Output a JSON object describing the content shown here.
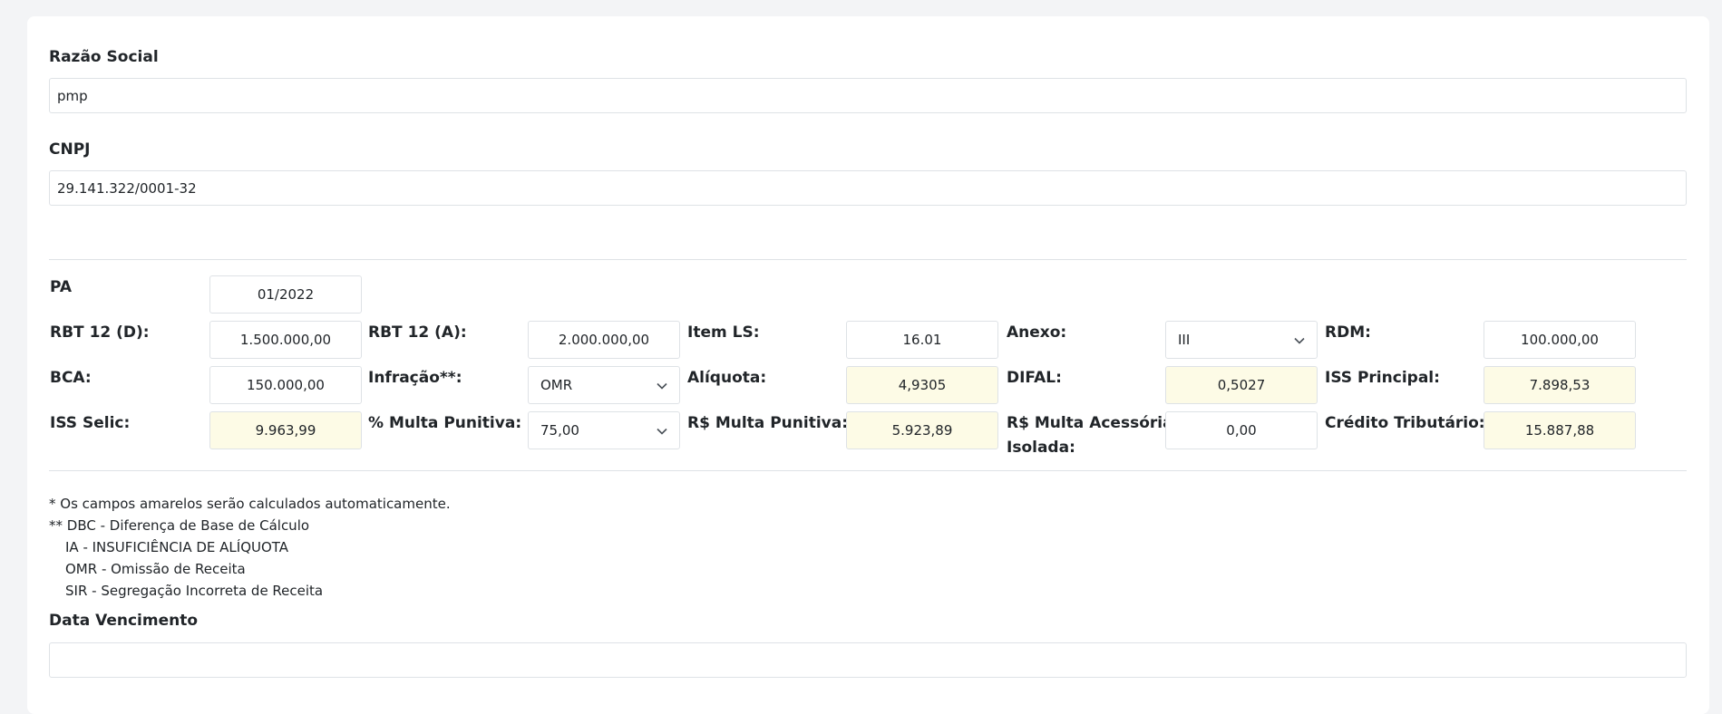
{
  "razao": {
    "label": "Razão Social",
    "value": "pmp"
  },
  "cnpj": {
    "label": "CNPJ",
    "value": "29.141.322/0001-32"
  },
  "pa": {
    "label": "PA",
    "value": "01/2022"
  },
  "rbt12d": {
    "label": "RBT 12 (D):",
    "value": "1.500.000,00"
  },
  "rbt12a": {
    "label": "RBT 12 (A):",
    "value": "2.000.000,00"
  },
  "itemls": {
    "label": "Item LS:",
    "value": "16.01"
  },
  "anexo": {
    "label": "Anexo:",
    "value": "III"
  },
  "rdm": {
    "label": "RDM:",
    "value": "100.000,00"
  },
  "bca": {
    "label": "BCA:",
    "value": "150.000,00"
  },
  "infracao": {
    "label": "Infração**:",
    "value": "OMR"
  },
  "aliquota": {
    "label": "Alíquota:",
    "value": "4,9305"
  },
  "difal": {
    "label": "DIFAL:",
    "value": "0,5027"
  },
  "iss_principal": {
    "label": "ISS Principal:",
    "value": "7.898,53"
  },
  "iss_selic": {
    "label": "ISS Selic:",
    "value": "9.963,99"
  },
  "pct_multa": {
    "label": "% Multa Punitiva:",
    "value": "75,00"
  },
  "rs_multa": {
    "label": "R$ Multa Punitiva:",
    "value": "5.923,89"
  },
  "rs_multa_acessoria": {
    "label_line1": "R$ Multa Acessória",
    "label_line2": "Isolada:",
    "value": "0,00"
  },
  "credito": {
    "label": "Crédito Tributário:",
    "value": "15.887,88"
  },
  "notes": {
    "line1": "* Os campos amarelos serão calculados automaticamente.",
    "line2": "** DBC - Diferença de Base de Cálculo",
    "line3": "IA - INSUFICIÊNCIA DE ALÍQUOTA",
    "line4": "OMR - Omissão de Receita",
    "line5": "SIR - Segregação Incorreta de Receita"
  },
  "data_vencimento": {
    "label": "Data Vencimento",
    "value": ""
  },
  "colors": {
    "calc_field_bg": "#fdfbe6",
    "border": "#dee2e6",
    "page_bg": "#f3f4f6"
  },
  "icons": {
    "select_chevron": "chevron-down-icon"
  }
}
